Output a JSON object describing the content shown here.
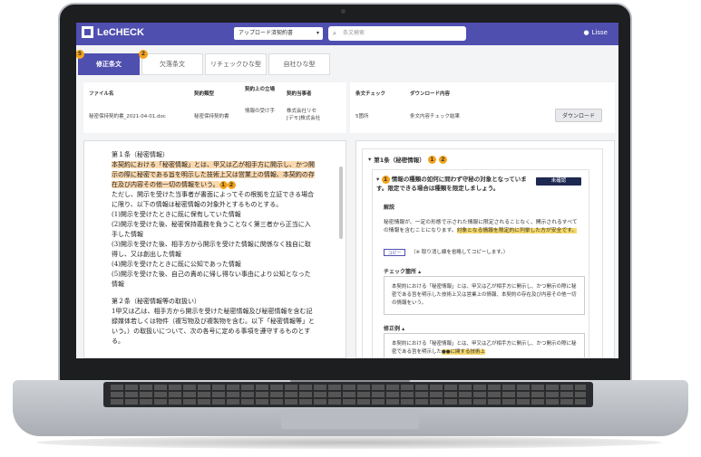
{
  "header": {
    "logo_text": "LeCHECK",
    "contract_type_select": "アップロード済契約書",
    "search_placeholder": "条文検索",
    "user_name": "Lisse"
  },
  "tabs": [
    {
      "label": "修正条文",
      "badge": "5"
    },
    {
      "label": "欠落条文",
      "badge": "2"
    },
    {
      "label": "リチェックひな型"
    },
    {
      "label": "自社ひな型"
    }
  ],
  "file_info": {
    "headers": [
      "ファイル名",
      "契約類型",
      "契約上の立場",
      "契約当事者"
    ],
    "values": [
      "秘密保持契約書_2021-04-01.doc",
      "秘密保持契約書",
      "情報の受け手",
      "株式会社リセ\n[デモ]株式会社"
    ]
  },
  "download_info": {
    "headers": [
      "条文チェック",
      "ダウンロード内容"
    ],
    "values": [
      "5箇所",
      "条文内容チェック結果"
    ],
    "button_label": "ダウンロード"
  },
  "document": {
    "article1_title": "第１条（秘密情報）",
    "article1_highlight": "本契約における「秘密情報」とは、甲又は乙が相手方に開示し、かつ開示の際に秘密である旨を明示した技術上又は営業上の情報、本契約の存在及び内容その他一切の情報をいう。",
    "marker1": "1",
    "marker2": "2",
    "article1_rest": "ただし、開示を受けた当事者が書面によってその根拠を立証できる場合に限り、以下の情報は秘密情報の対象外とするものとする。",
    "items": [
      "(1)開示を受けたときに既に保有していた情報",
      "(2)開示を受けた後、秘密保持義務を負うことなく第三者から正当に入手した情報",
      "(3)開示を受けた後、相手方から開示を受けた情報に関係なく独自に取得し、又は創出した情報",
      "(4)開示を受けたときに既に公知であった情報",
      "(5)開示を受けた後、自己の責めに帰し得ない事由により公知となった情報"
    ],
    "article2_title": "第２条（秘密情報等の取扱い）",
    "article2_text": "1甲又は乙は、相手方から開示を受けた秘密情報及び秘密情報を含む記録媒体若しくは物件（複写物及び複製物を含む。以下「秘密情報等」という。）の取扱いについて、次の各号に定める事項を遵守するものとする。"
  },
  "review": {
    "article_title": "第1条（秘密情報）",
    "risk_marker": "1",
    "risk_text": "情報の種類の如何に問わず守秘の対象となっています。限定できる場合は種類を限定しましょう。",
    "status_label": "未確認",
    "explanation_label": "解説",
    "explanation_text": "秘密情報が、一定の形態で示された情報に限定されることなく、開示されるすべての情報を含むことになります。",
    "explanation_highlight": "対象となる情報を限定的に列挙した方が安全です。",
    "copy_button": "コピー",
    "copy_note": "（※ 取り消し線を省略してコピーします。）",
    "check_label": "チェック箇所",
    "check_text": "本契約における「秘密情報」とは、甲又は乙が相手方に開示し、かつ開示の際に秘密である旨を明示した技術上又は営業上の情報、本契約の存在及び内容その他一切の情報をいう。",
    "revision_label": "修正例",
    "revision_text": "本契約における「秘密情報」とは、甲又は乙が相手方に開示し、かつ開示の際に秘密である旨を明示した",
    "revision_highlight": "●●に関する技術上"
  }
}
